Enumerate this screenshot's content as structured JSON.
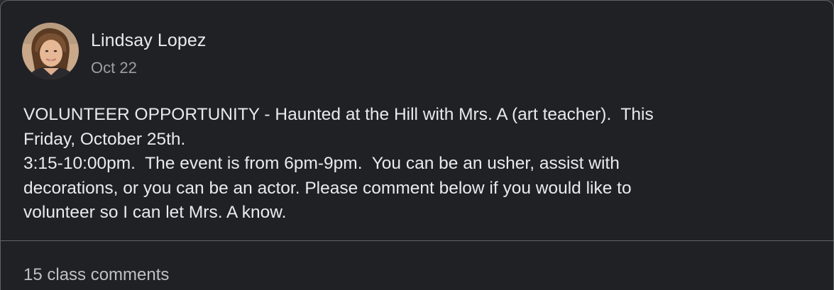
{
  "post": {
    "author": "Lindsay Lopez",
    "date": "Oct 22",
    "body_lines": [
      "VOLUNTEER OPPORTUNITY - Haunted at the Hill with Mrs. A (art teacher).  This",
      "Friday, October 25th.",
      "3:15-10:00pm.  The event is from 6pm-9pm.  You can be an usher, assist with",
      "decorations, or you can be an actor. Please comment below if you would like to",
      "volunteer so I can let Mrs. A know."
    ],
    "comments_label": "15 class comments"
  },
  "colors": {
    "background": "#202124",
    "text_primary": "#e8eaed",
    "text_secondary": "#9aa0a6",
    "border": "#5f6368"
  }
}
